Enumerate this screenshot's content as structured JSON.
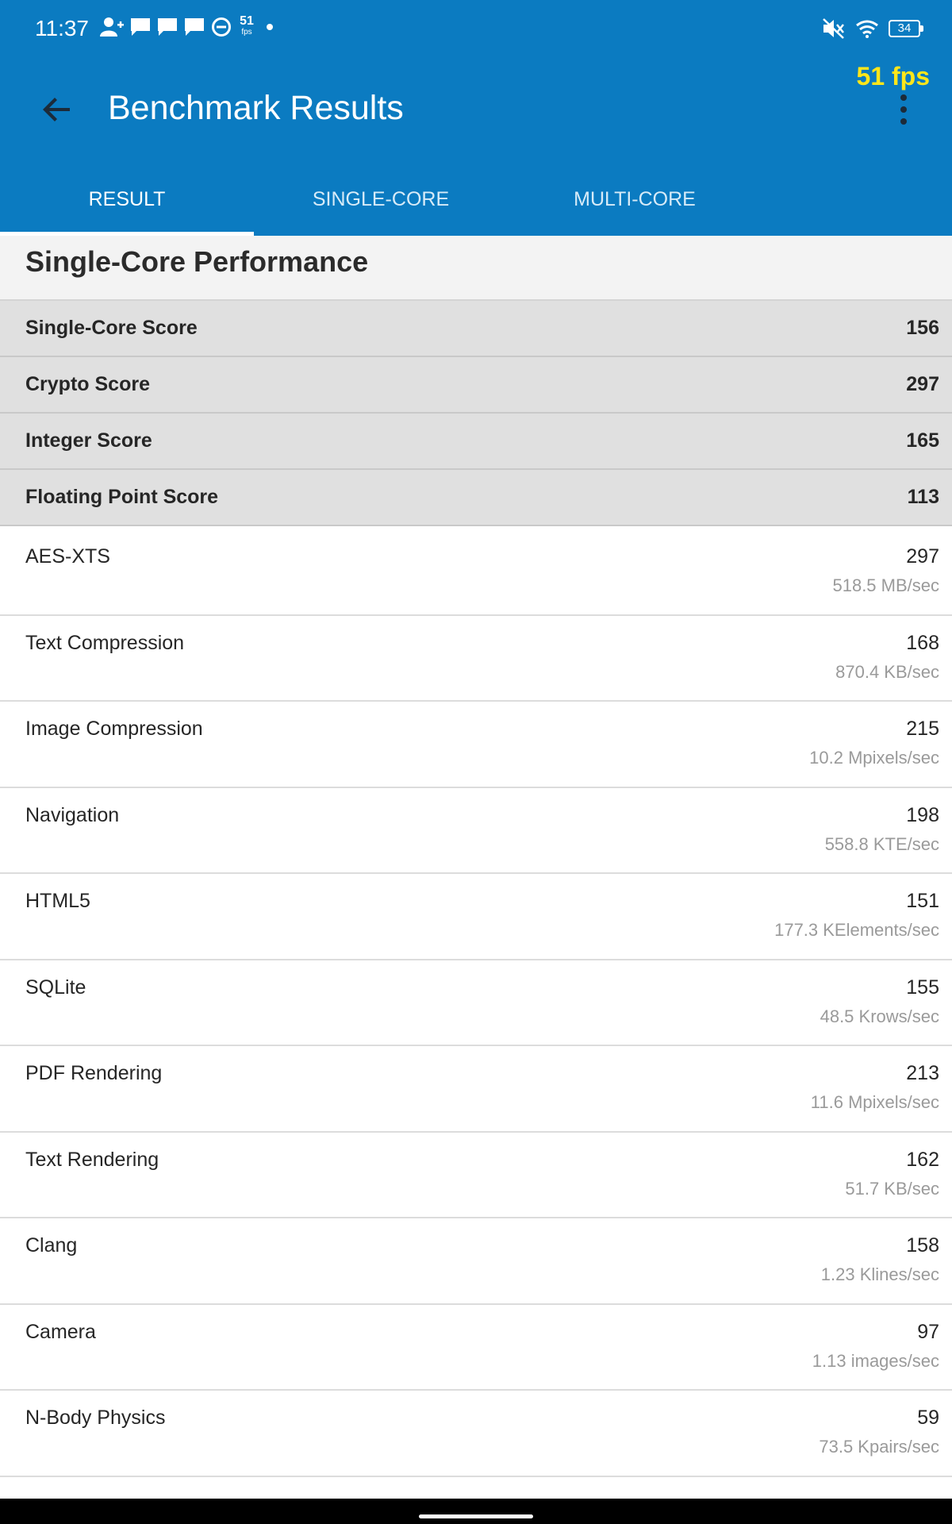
{
  "status_bar": {
    "time": "11:37",
    "fps_indicator_value": "51",
    "fps_indicator_unit": "fps",
    "battery": "34"
  },
  "fps_overlay": "51 fps",
  "header": {
    "title": "Benchmark Results"
  },
  "tabs": [
    {
      "label": "RESULT",
      "active": true
    },
    {
      "label": "SINGLE-CORE",
      "active": false
    },
    {
      "label": "MULTI-CORE",
      "active": false
    }
  ],
  "section": {
    "title": "Single-Core Performance"
  },
  "summary_scores": [
    {
      "label": "Single-Core Score",
      "value": "156"
    },
    {
      "label": "Crypto Score",
      "value": "297"
    },
    {
      "label": "Integer Score",
      "value": "165"
    },
    {
      "label": "Floating Point Score",
      "value": "113"
    }
  ],
  "workloads": [
    {
      "name": "AES-XTS",
      "score": "297",
      "rate": "518.5 MB/sec"
    },
    {
      "name": "Text Compression",
      "score": "168",
      "rate": "870.4 KB/sec"
    },
    {
      "name": "Image Compression",
      "score": "215",
      "rate": "10.2 Mpixels/sec"
    },
    {
      "name": "Navigation",
      "score": "198",
      "rate": "558.8 KTE/sec"
    },
    {
      "name": "HTML5",
      "score": "151",
      "rate": "177.3 KElements/sec"
    },
    {
      "name": "SQLite",
      "score": "155",
      "rate": "48.5 Krows/sec"
    },
    {
      "name": "PDF Rendering",
      "score": "213",
      "rate": "11.6 Mpixels/sec"
    },
    {
      "name": "Text Rendering",
      "score": "162",
      "rate": "51.7 KB/sec"
    },
    {
      "name": "Clang",
      "score": "158",
      "rate": "1.23 Klines/sec"
    },
    {
      "name": "Camera",
      "score": "97",
      "rate": "1.13 images/sec"
    },
    {
      "name": "N-Body Physics",
      "score": "59",
      "rate": "73.5 Kpairs/sec"
    }
  ],
  "colors": {
    "appbar": "#0b7bc1",
    "fps_overlay": "#ffe61a",
    "summary_bg": "#e0e0e0"
  }
}
